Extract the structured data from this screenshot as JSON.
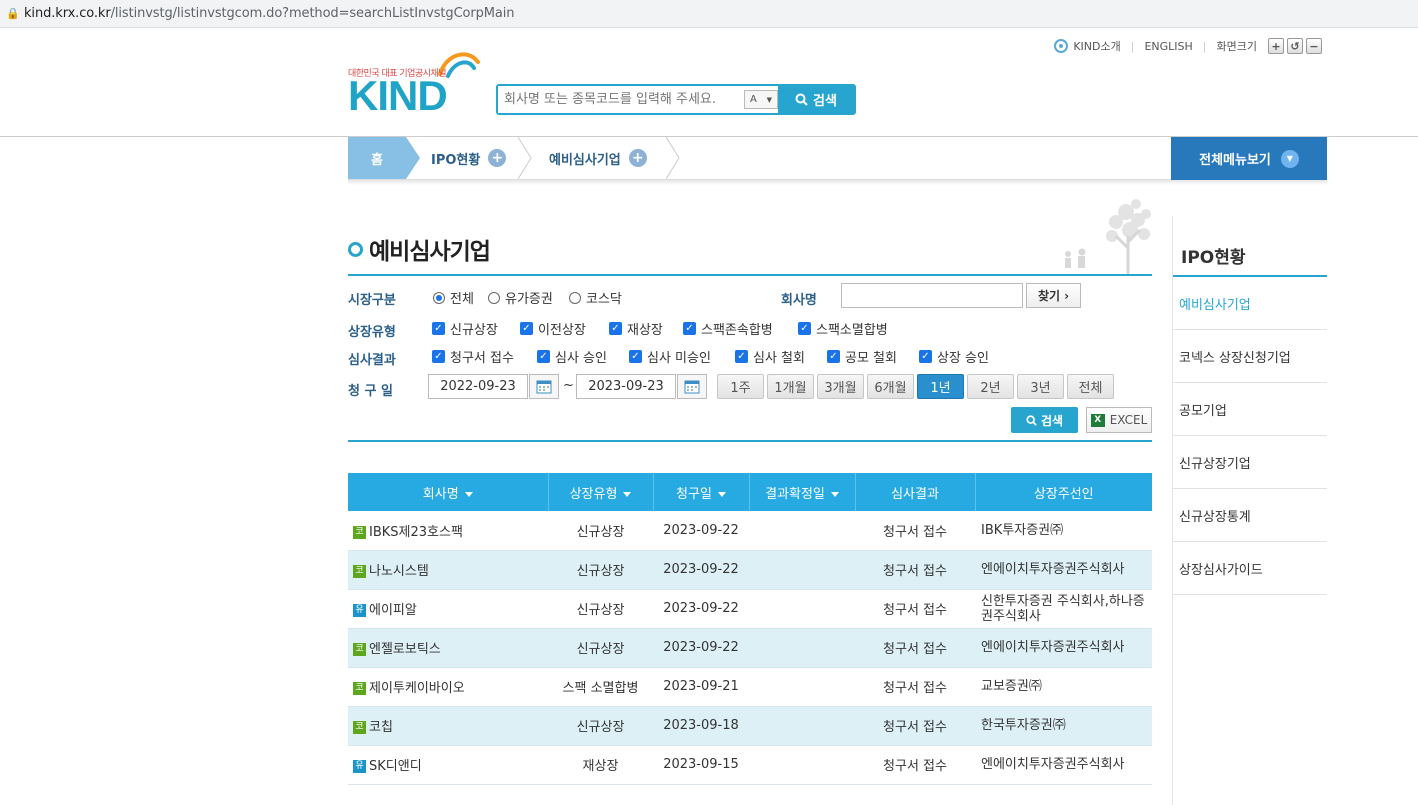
{
  "browser": {
    "url_host": "kind.krx.co.kr",
    "url_path": "/listinvstg/listinvstgcom.do?method=searchListInvstgCorpMain"
  },
  "topbar": {
    "kind_intro": "KIND소개",
    "english": "ENGLISH",
    "zoom_label": "화면크기",
    "zoom_in": "+",
    "zoom_reset": "↺",
    "zoom_out": "−"
  },
  "logo": {
    "tagline": "대한민국 대표 기업공시채널",
    "word": "KIND"
  },
  "search": {
    "placeholder": "회사명 또는 종목코드를 입력해 주세요.",
    "a_toggle": "A",
    "button": "검색"
  },
  "breadcrumb": {
    "home": "홈",
    "level1": "IPO현황",
    "level2": "예비심사기업",
    "all_menu": "전체메뉴보기"
  },
  "page_title": "예비심사기업",
  "filters": {
    "market_label": "시장구분",
    "market_options": [
      {
        "label": "전체",
        "checked": true
      },
      {
        "label": "유가증권",
        "checked": false
      },
      {
        "label": "코스닥",
        "checked": false
      }
    ],
    "company_label": "회사명",
    "company_value": "",
    "find_button": "찾기",
    "listing_type_label": "상장유형",
    "listing_types": [
      "신규상장",
      "이전상장",
      "재상장",
      "스팩존속합병",
      "스팩소멸합병"
    ],
    "result_label": "심사결과",
    "results": [
      "청구서 접수",
      "심사 승인",
      "심사 미승인",
      "심사 철회",
      "공모 철회",
      "상장 승인"
    ],
    "date_label": "청 구 일",
    "date_from": "2022-09-23",
    "date_sep": "~",
    "date_to": "2023-09-23",
    "ranges": [
      "1주",
      "1개월",
      "3개월",
      "6개월",
      "1년",
      "2년",
      "3년",
      "전체"
    ],
    "selected_range": "1년",
    "search_button": "검색",
    "excel_button": "EXCEL"
  },
  "table": {
    "headers": [
      "회사명",
      "상장유형",
      "청구일",
      "결과확정일",
      "심사결과",
      "상장주선인"
    ],
    "rows": [
      {
        "market": "코",
        "name": "IBKS제23호스팩",
        "type": "신규상장",
        "date": "2023-09-22",
        "confirm": "",
        "result": "청구서 접수",
        "agent": "IBK투자증권㈜"
      },
      {
        "market": "코",
        "name": "나노시스템",
        "type": "신규상장",
        "date": "2023-09-22",
        "confirm": "",
        "result": "청구서 접수",
        "agent": "엔에이치투자증권주식회사"
      },
      {
        "market": "유",
        "name": "에이피알",
        "type": "신규상장",
        "date": "2023-09-22",
        "confirm": "",
        "result": "청구서 접수",
        "agent": "신한투자증권 주식회사,하나증권주식회사"
      },
      {
        "market": "코",
        "name": "엔젤로보틱스",
        "type": "신규상장",
        "date": "2023-09-22",
        "confirm": "",
        "result": "청구서 접수",
        "agent": "엔에이치투자증권주식회사"
      },
      {
        "market": "코",
        "name": "제이투케이바이오",
        "type": "스팩 소멸합병",
        "date": "2023-09-21",
        "confirm": "",
        "result": "청구서 접수",
        "agent": "교보증권㈜"
      },
      {
        "market": "코",
        "name": "코칩",
        "type": "신규상장",
        "date": "2023-09-18",
        "confirm": "",
        "result": "청구서 접수",
        "agent": "한국투자증권㈜"
      },
      {
        "market": "유",
        "name": "SK디앤디",
        "type": "재상장",
        "date": "2023-09-15",
        "confirm": "",
        "result": "청구서 접수",
        "agent": "엔에이치투자증권주식회사"
      }
    ]
  },
  "sidebar": {
    "title": "IPO현황",
    "items": [
      "예비심사기업",
      "코넥스 상장신청기업",
      "공모기업",
      "신규상장기업",
      "신규상장통계",
      "상장심사가이드"
    ],
    "active": "예비심사기업"
  },
  "colors": {
    "accent": "#27a5cf",
    "table_header": "#27aae1",
    "row_alt": "#ddf0f6",
    "menu_blue": "#2878bc"
  }
}
